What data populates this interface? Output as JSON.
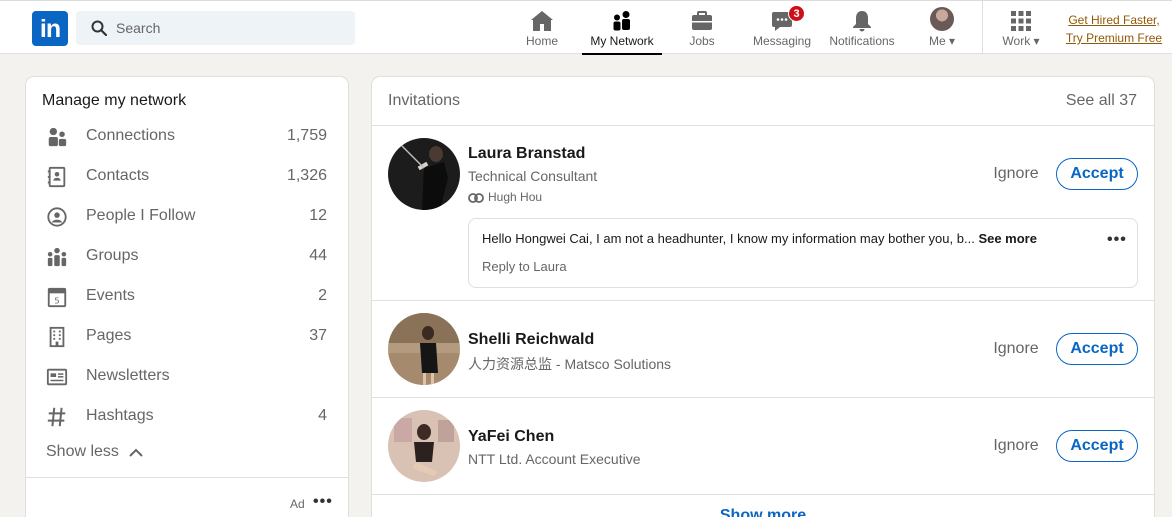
{
  "header": {
    "logo_text": "in",
    "search_placeholder": "Search",
    "nav": [
      {
        "label": "Home",
        "icon": "home-icon"
      },
      {
        "label": "My Network",
        "icon": "network-icon"
      },
      {
        "label": "Jobs",
        "icon": "briefcase-icon"
      },
      {
        "label": "Messaging",
        "icon": "messaging-icon",
        "badge": "3"
      },
      {
        "label": "Notifications",
        "icon": "bell-icon"
      },
      {
        "label": "Me",
        "icon": "avatar"
      },
      {
        "label": "Work",
        "icon": "grid-icon"
      }
    ],
    "premium_line1": "Get Hired Faster,",
    "premium_line2": "Try Premium Free"
  },
  "network": {
    "heading": "Manage my network",
    "items": [
      {
        "label": "Connections",
        "count": "1,759",
        "icon": "connections-icon"
      },
      {
        "label": "Contacts",
        "count": "1,326",
        "icon": "contacts-icon"
      },
      {
        "label": "People I Follow",
        "count": "12",
        "icon": "follow-icon"
      },
      {
        "label": "Groups",
        "count": "44",
        "icon": "groups-icon"
      },
      {
        "label": "Events",
        "count": "2",
        "icon": "calendar-icon"
      },
      {
        "label": "Pages",
        "count": "37",
        "icon": "building-icon"
      },
      {
        "label": "Newsletters",
        "count": "",
        "icon": "newsletter-icon"
      },
      {
        "label": "Hashtags",
        "count": "4",
        "icon": "hashtag-icon"
      }
    ],
    "show_less": "Show less",
    "ad_label": "Ad",
    "ad_more": "•••"
  },
  "invitations": {
    "heading": "Invitations",
    "see_all": "See all 37",
    "ignore_label": "Ignore",
    "accept_label": "Accept",
    "items": [
      {
        "name": "Laura Branstad",
        "title": "Technical Consultant",
        "mutual": "Hugh Hou",
        "message": "Hello Hongwei Cai, I am not a headhunter, I know my information may bother you, b...",
        "see_more": "See more",
        "reply": "Reply to Laura",
        "dots": "•••"
      },
      {
        "name": "Shelli Reichwald",
        "title": "人力资源总监 - Matsco Solutions"
      },
      {
        "name": "YaFei Chen",
        "title": "NTT Ltd. Account Executive"
      }
    ],
    "show_more": "Show more"
  },
  "colors": {
    "brand": "#0a66c2",
    "badge": "#cc1016",
    "premium": "#915907"
  }
}
